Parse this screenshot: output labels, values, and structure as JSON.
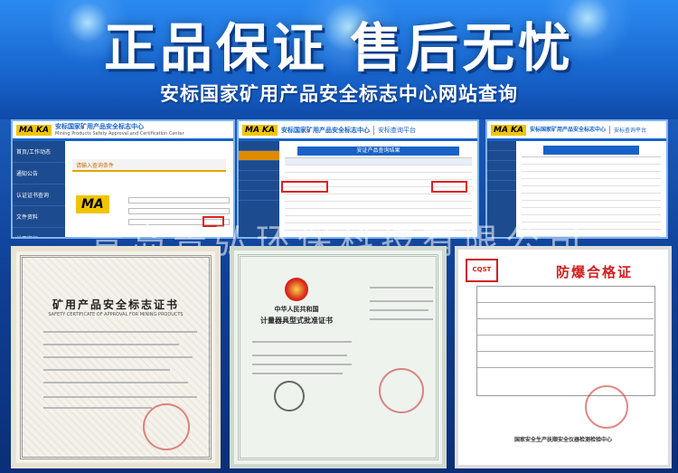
{
  "banner": {
    "headline": "正品保证  售后无忧",
    "subheadline": "安标国家矿用产品安全标志中心网站查询"
  },
  "screens": {
    "left": {
      "logo": "MA KA",
      "site_title": "安标国家矿用产品安全标志中心",
      "site_subtitle": "Mining Products Safety Approval and Certification Center",
      "menu": [
        "首页/工作动态",
        "通知公告",
        "认证证书查询",
        "文件资料",
        "关于安标"
      ],
      "query_heading": "请输入查询条件",
      "big_logo": "MA"
    },
    "middle": {
      "logo": "MA KA",
      "site_title": "安标国家矿用产品安全标志中心",
      "portal": "安标查询平台",
      "table_title": "安证产品查询结果"
    },
    "right": {
      "logo": "MA KA",
      "site_title": "安标国家矿用产品安全标志中心",
      "portal": "安标查询平台"
    }
  },
  "watermark": "青岛景弘环保科技有限公司",
  "certificates": {
    "mining": {
      "title": "矿用产品安全标志证书",
      "title_en": "SAFETY CERTIFICATE OF APPROVAL FOR MINING PRODUCTS"
    },
    "metrology": {
      "header": "中华人民共和国",
      "title": "计量器具型式批准证书"
    },
    "explosion": {
      "org": "CQST",
      "title": "防爆合格证",
      "footer": "国家安全生产抚顺安全仪器检测检验中心"
    }
  },
  "colors": {
    "banner_blue": "#1866cf",
    "site_blue": "#1662c8",
    "highlight_red": "#e02020",
    "logo_yellow": "#f0c400"
  }
}
